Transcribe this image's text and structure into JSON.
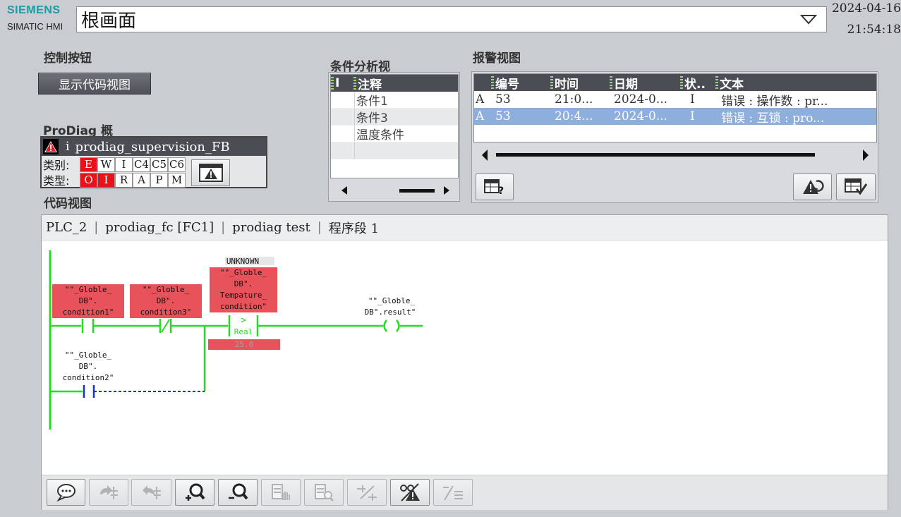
{
  "header": {
    "brand": "SIEMENS",
    "sub_brand": "SIMATIC HMI",
    "screen_name": "根画面",
    "date": "2024-04-16",
    "time": "21:54:18"
  },
  "control": {
    "title": "控制按钮",
    "show_code_button": "显示代码视图"
  },
  "prodiag": {
    "title": "ProDiag 概",
    "info_glyph": "i",
    "name": "prodiag_supervision_FB",
    "category_label": "类别:",
    "category_cells": [
      "E",
      "W",
      "I",
      "C4",
      "C5",
      "C6"
    ],
    "type_label": "类型:",
    "type_cells": [
      "O",
      "I",
      "R",
      "A",
      "P",
      "M"
    ]
  },
  "condition_view": {
    "title": "条件分析视",
    "col1_header": "I",
    "col2_header": "注释",
    "rows": [
      "条件1",
      "条件3",
      "温度条件",
      ""
    ]
  },
  "alarm_view": {
    "title": "报警视图",
    "headers": [
      "编号",
      "时间",
      "日期",
      "状..",
      "文本"
    ],
    "rows": [
      {
        "flag": "A",
        "num": "53",
        "time": "21:0...",
        "date": "2024-0...",
        "state": "I",
        "text": "错误 : 操作数 : pr..."
      },
      {
        "flag": "A",
        "num": "53",
        "time": "20:4...",
        "date": "2024-0...",
        "state": "I",
        "text": "错误 : 互锁 : pro..."
      }
    ]
  },
  "code_view": {
    "title": "代码视图",
    "breadcrumb": [
      "PLC_2",
      "prodiag_fc [FC1]",
      "prodiag test",
      "程序段 1"
    ],
    "ladder": {
      "unknown_label": "UNKNOWN",
      "contact1": [
        "\"\"_Globle_",
        "DB\".",
        "condition1\""
      ],
      "contact3": [
        "\"\"_Globle_",
        "DB\".",
        "condition3\""
      ],
      "compare": [
        "\"\"_Globle_",
        "DB\".",
        "Tempature_",
        "condition\""
      ],
      "compare_op": ">",
      "compare_type": "Real",
      "compare_value": "25.0",
      "coil": [
        "\"\"_Globle_",
        "DB\".result\""
      ],
      "contact2": [
        "\"\"_Globle_",
        "DB\".",
        "condition2\""
      ]
    }
  },
  "colors": {
    "energized": "#22dd22",
    "fault_box": "#e8535b",
    "dashed": "#1a2fd0",
    "header_bar": "#4a4e54",
    "selected_row": "#8eaedc",
    "brand": "#1a9ba6"
  }
}
